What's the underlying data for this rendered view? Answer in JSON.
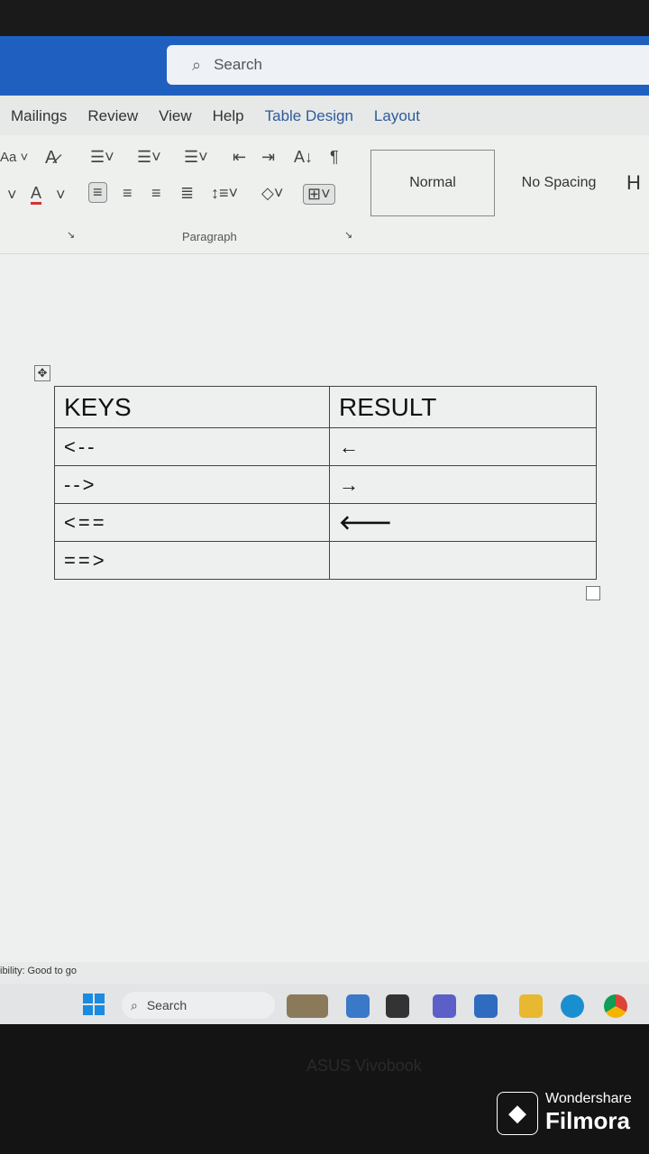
{
  "titlebar": {
    "search_placeholder": "Search",
    "search_icon": "search-icon"
  },
  "tabs": [
    "Mailings",
    "Review",
    "View",
    "Help",
    "Table Design",
    "Layout"
  ],
  "ribbon": {
    "font_case": "Aa",
    "paragraph_group": "Paragraph",
    "styles": [
      "Normal",
      "No Spacing",
      "H"
    ],
    "font_color": "#d13438"
  },
  "table": {
    "headers": [
      "KEYS",
      "RESULT"
    ],
    "rows": [
      [
        "<--",
        "←"
      ],
      [
        "-->",
        "→"
      ],
      [
        "<==",
        "🡐"
      ],
      [
        "==>",
        ""
      ]
    ]
  },
  "status": {
    "accessibility": "ibility: Good to go"
  },
  "taskbar": {
    "search_label": "Search"
  },
  "laptop_brand": "ASUS Vivobook",
  "watermark": {
    "line1": "Wondershare",
    "line2": "Filmora"
  }
}
